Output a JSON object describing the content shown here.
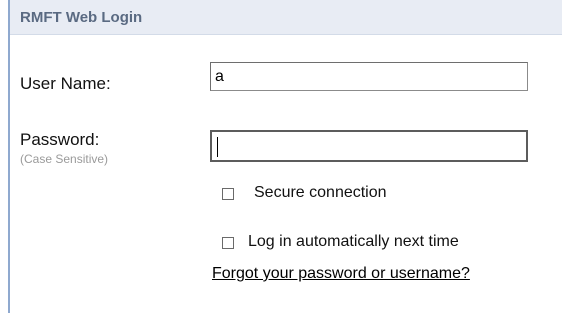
{
  "panel": {
    "title": "RMFT Web Login"
  },
  "username": {
    "label": "User Name:",
    "value": "a"
  },
  "password": {
    "label": "Password:",
    "hint": "(Case Sensitive)",
    "value": ""
  },
  "options": {
    "secure_label": "Secure connection",
    "secure_checked": false,
    "auto_login_label": "Log in automatically next time",
    "auto_login_checked": false
  },
  "forgot_link": "Forgot your password or username?",
  "colors": {
    "accent_border": "#8fa9cf",
    "titlebar_bg": "#e8ecf4",
    "title_text": "#5a6a82"
  }
}
